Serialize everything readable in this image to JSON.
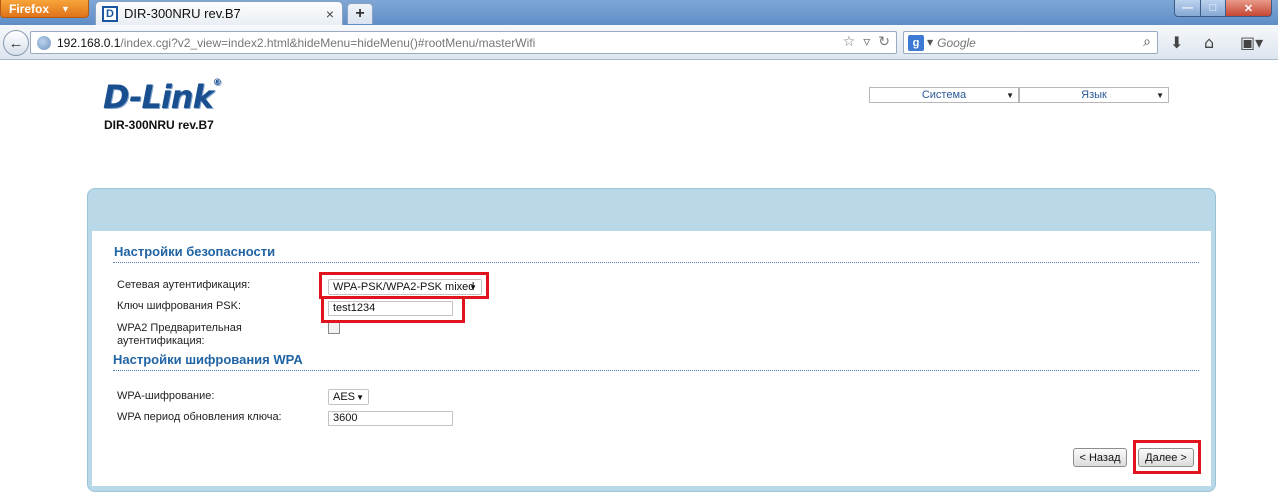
{
  "browser": {
    "menu_button": "Firefox",
    "tab": {
      "title": "DIR-300NRU rev.B7",
      "favicon": "D"
    },
    "url": {
      "host": "192.168.0.1",
      "path": "/index.cgi?v2_view=index2.html&hideMenu=hideMenu()#rootMenu/masterWifi"
    },
    "search": {
      "placeholder": "Google",
      "engine_letter": "g"
    }
  },
  "header": {
    "logo_text": "D-Link",
    "logo_mark": "®",
    "model": "DIR-300NRU rev.B7",
    "menus": {
      "system": "Система",
      "language": "Язык"
    }
  },
  "security": {
    "title": "Настройки безопасности",
    "auth_label": "Сетевая аутентификация:",
    "auth_value": "WPA-PSK/WPA2-PSK mixed",
    "psk_label": "Ключ шифрования PSK:",
    "psk_value": "test1234",
    "preauth_label": "WPA2 Предварительная аутентификация:",
    "preauth_checked": false
  },
  "wpa": {
    "title": "Настройки шифрования WPA",
    "enc_label": "WPA-шифрование:",
    "enc_value": "AES",
    "period_label": "WPA период обновления ключа:",
    "period_value": "3600"
  },
  "buttons": {
    "back": "< Назад",
    "next": "Далее >"
  },
  "colors": {
    "brand": "#1a4f8f",
    "section_title": "#2164a4",
    "panel": "#b9d9e8",
    "highlight": "#e0141c"
  }
}
